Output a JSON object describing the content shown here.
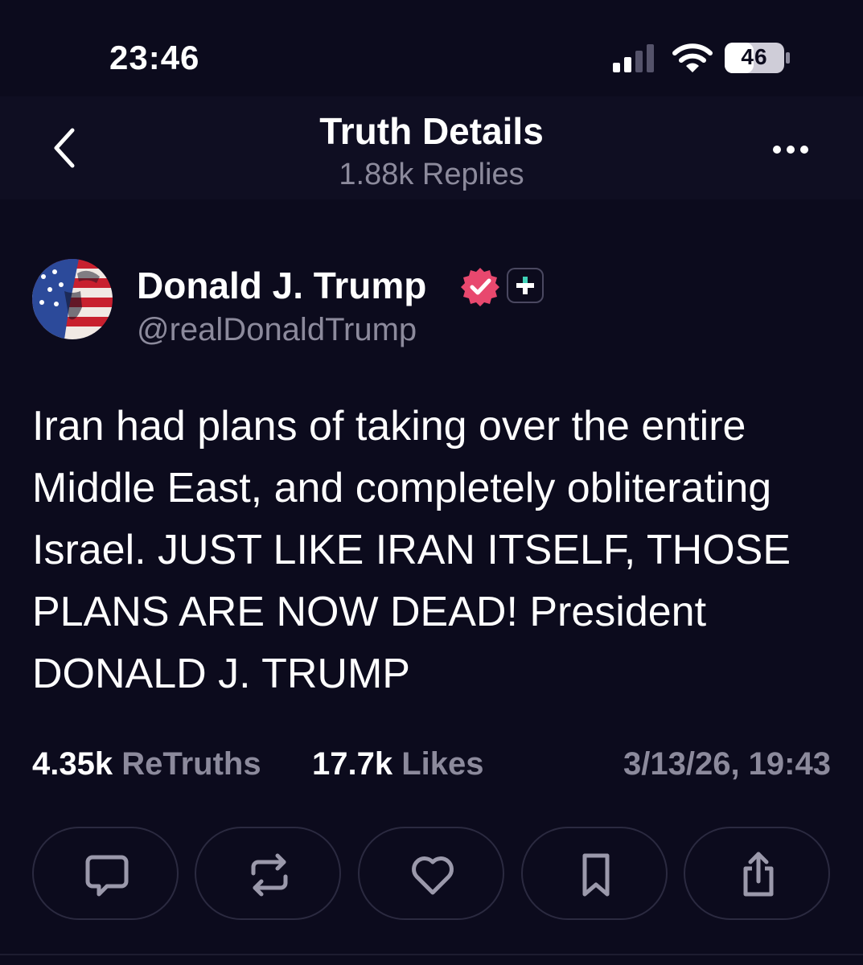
{
  "status_bar": {
    "time": "23:46",
    "battery": "46",
    "icons": [
      "signal-icon",
      "wifi-icon",
      "battery-icon"
    ]
  },
  "header": {
    "title": "Truth Details",
    "subtitle": "1.88k Replies",
    "icons": [
      "chevron-left-icon",
      "more-horizontal-icon"
    ]
  },
  "post": {
    "author": {
      "name": "Donald J. Trump",
      "handle": "@realDonaldTrump",
      "badges": [
        "verified-icon",
        "plus-icon"
      ]
    },
    "text": "Iran had plans of taking over the entire Middle East, and completely obliterating Israel. JUST LIKE IRAN ITSELF, THOSE PLANS ARE NOW DEAD! President DONALD J. TRUMP",
    "stats": {
      "retruths_count": "4.35k",
      "retruths_label": "ReTruths",
      "likes_count": "17.7k",
      "likes_label": "Likes",
      "date": "3/13/26, 19:43"
    },
    "actions": [
      "reply-icon",
      "retruth-icon",
      "like-icon",
      "bookmark-icon",
      "share-icon"
    ]
  },
  "colors": {
    "background": "#0c0b1d",
    "header_background": "#0f0e22",
    "muted_text": "#8c8a9c",
    "verified_badge": "#e8486e",
    "button_border": "#2b2a40",
    "icon_gray": "#9b99ab"
  }
}
